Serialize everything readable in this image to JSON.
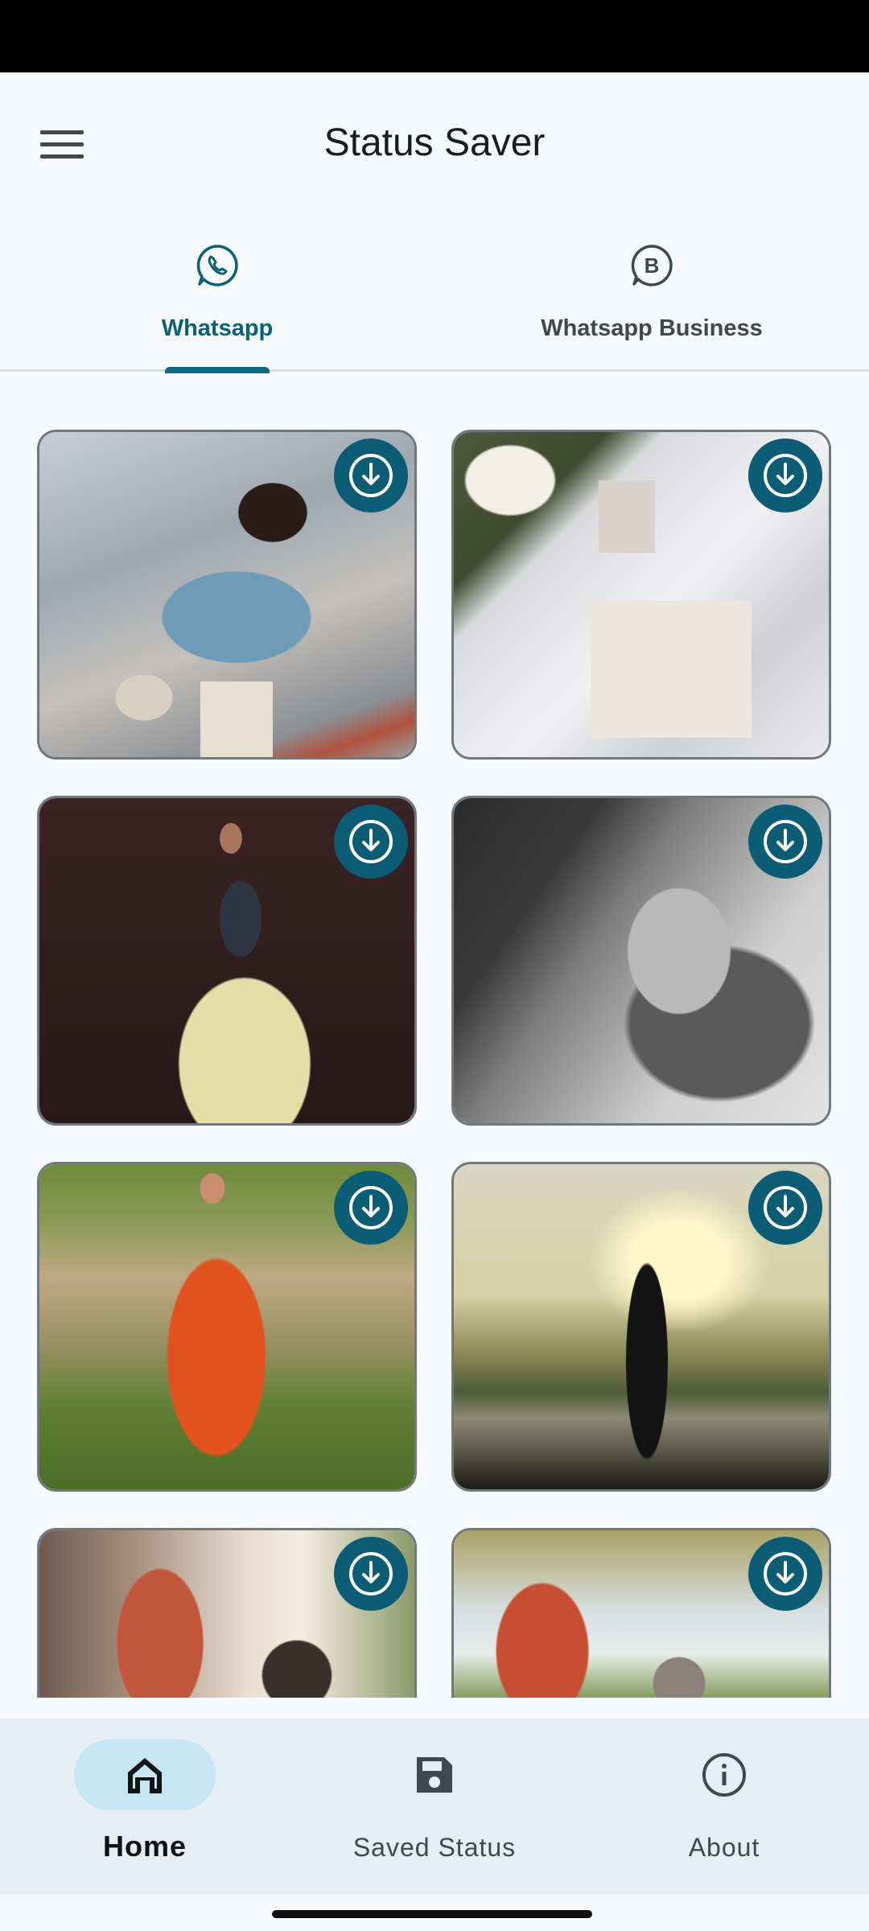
{
  "app": {
    "title": "Status Saver"
  },
  "tabs": [
    {
      "label": "Whatsapp",
      "icon": "whatsapp-icon",
      "active": true
    },
    {
      "label": "Whatsapp Business",
      "icon": "whatsapp-business-icon",
      "active": false
    }
  ],
  "status_items": [
    {
      "subject": "woman in blue sweater with shopping bags",
      "action_icon": "download-icon"
    },
    {
      "subject": "white flowers and book on satin cloth",
      "action_icon": "download-icon"
    },
    {
      "subject": "woman in ruffled yellow skirt",
      "action_icon": "download-icon"
    },
    {
      "subject": "black and white portrait by car window",
      "action_icon": "download-icon"
    },
    {
      "subject": "woman in orange dress in field",
      "action_icon": "download-icon"
    },
    {
      "subject": "silhouette of man at sunset by lake",
      "action_icon": "download-icon"
    },
    {
      "subject": "man walking dog in city",
      "action_icon": "download-icon"
    },
    {
      "subject": "man playing with dog on grass",
      "action_icon": "download-icon"
    }
  ],
  "bottom_nav": [
    {
      "label": "Home",
      "icon": "home-icon",
      "active": true
    },
    {
      "label": "Saved Status",
      "icon": "save-icon",
      "active": false
    },
    {
      "label": "About",
      "icon": "info-icon",
      "active": false
    }
  ],
  "colors": {
    "accent": "#0b6981",
    "download_button": "#0b5c75",
    "nav_pill": "#c5e6f2",
    "nav_background": "#e6edf3",
    "background": "#f7f9fc"
  }
}
